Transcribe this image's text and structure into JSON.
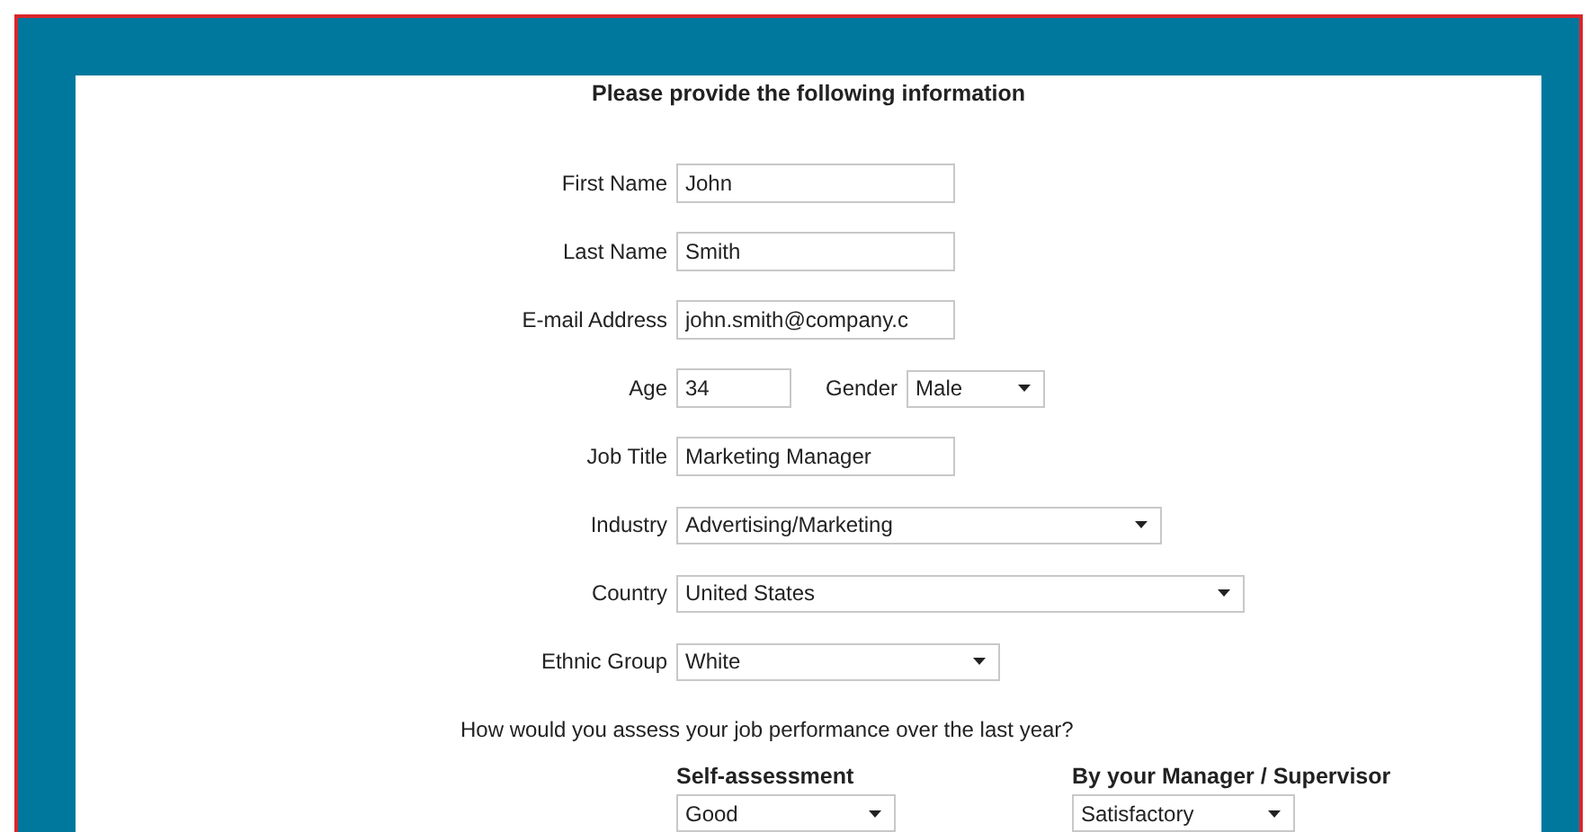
{
  "title": "Please provide the following information",
  "rows": [
    {
      "fields": [
        {
          "label": "First Name",
          "kind": "text",
          "value": "John"
        }
      ]
    },
    {
      "fields": [
        {
          "label": "Last Name",
          "kind": "text",
          "value": "Smith"
        }
      ]
    },
    {
      "fields": [
        {
          "label": "E-mail Address",
          "kind": "text",
          "value": "john.smith@company.c"
        }
      ]
    },
    {
      "fields": [
        {
          "label": "Age",
          "kind": "text",
          "value": "34"
        },
        {
          "label": "Gender",
          "kind": "select",
          "value": "Male"
        }
      ]
    },
    {
      "fields": [
        {
          "label": "Job Title",
          "kind": "text",
          "value": "Marketing Manager"
        }
      ]
    },
    {
      "fields": [
        {
          "label": "Industry",
          "kind": "select",
          "value": "Advertising/Marketing"
        }
      ]
    },
    {
      "fields": [
        {
          "label": "Country",
          "kind": "select",
          "value": "United States"
        }
      ]
    },
    {
      "fields": [
        {
          "label": "Ethnic Group",
          "kind": "select",
          "value": "White"
        }
      ]
    }
  ],
  "question": "How would you assess your job performance over the last year?",
  "assessments": [
    {
      "heading": "Self-assessment",
      "kind": "select",
      "value": "Good"
    },
    {
      "heading": "By your Manager / Supervisor",
      "kind": "select",
      "value": "Satisfactory"
    }
  ]
}
